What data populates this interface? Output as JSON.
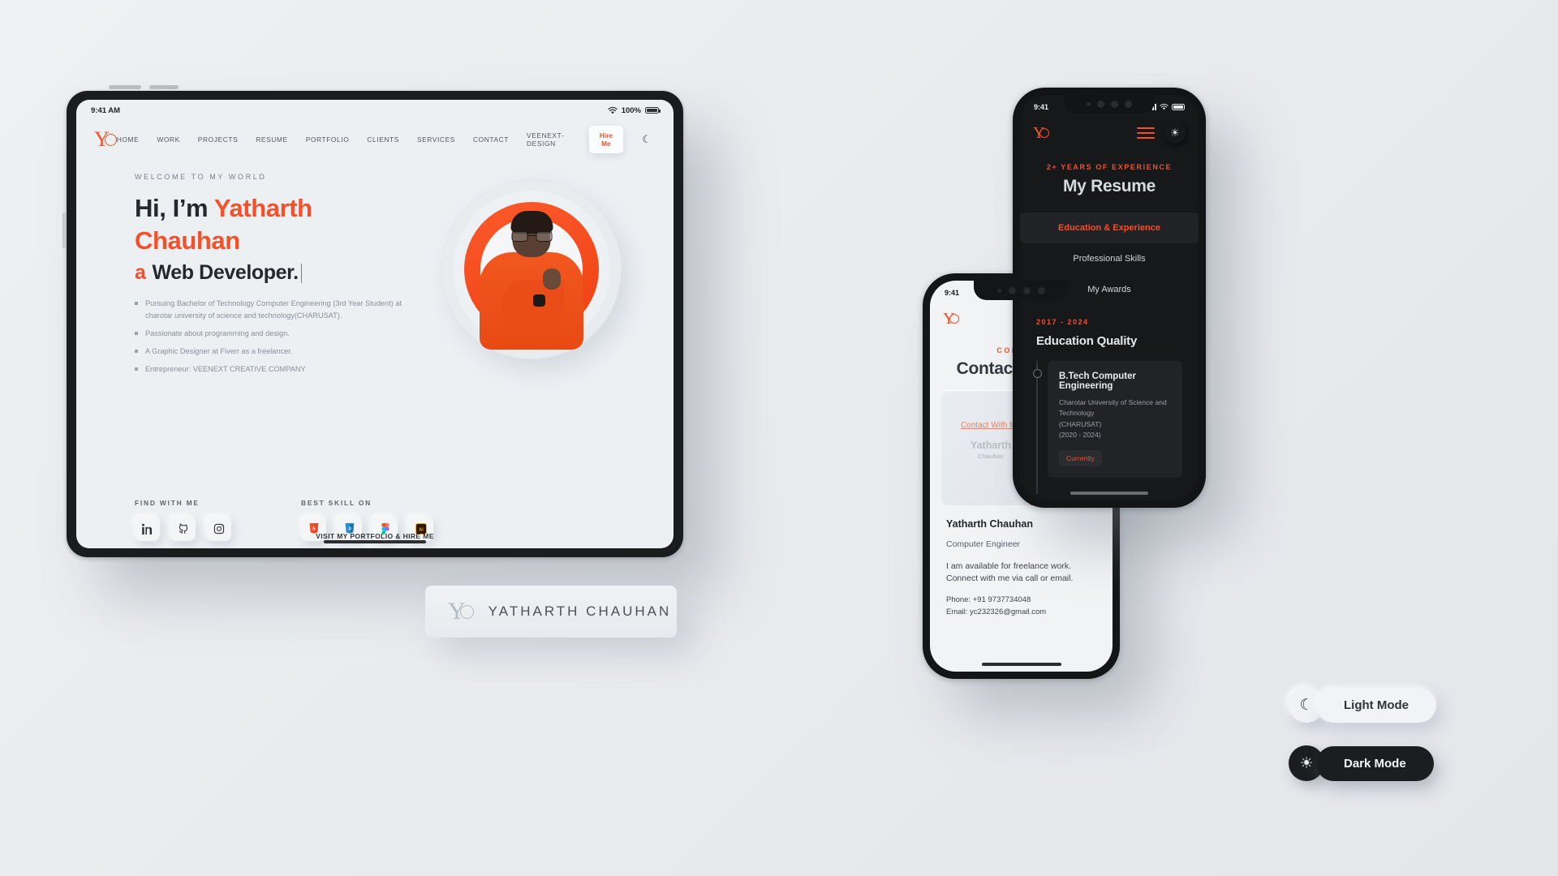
{
  "colors": {
    "accent": "#f4502a",
    "light_bg": "#edf0f3",
    "dark_bg": "#17181a",
    "dark_card": "#212326"
  },
  "tablet": {
    "status": {
      "time": "9:41 AM",
      "battery": "100%",
      "wifi_icon": "wifi-icon"
    },
    "logo": "YC",
    "nav": [
      {
        "label": "HOME"
      },
      {
        "label": "WORK"
      },
      {
        "label": "PROJECTS"
      },
      {
        "label": "RESUME"
      },
      {
        "label": "PORTFOLIO"
      },
      {
        "label": "CLIENTS"
      },
      {
        "label": "SERVICES"
      },
      {
        "label": "CONTACT"
      },
      {
        "label": "VEENEXT-DESIGN"
      }
    ],
    "hire_button": "Hire Me",
    "theme_toggle_icon": "moon-icon",
    "hero": {
      "eyebrow": "WELCOME TO MY WORLD",
      "greeting": "Hi, I’m ",
      "name": "Yatharth Chauhan",
      "role_article": "a",
      "role": "Web Developer.",
      "bullets": [
        "Pursuing Bachelor of Technology Computer Engineering (3rd Year Student) at charotar university of science and technology(CHARUSAT).",
        "Passionate about programming and design.",
        "A Graphic Designer at Fiverr as a freelancer.",
        "Entrepreneur: VEENEXT CREATIVE COMPANY"
      ]
    },
    "find_with_me": {
      "title": "FIND WITH ME",
      "items": [
        {
          "name": "linkedin-icon"
        },
        {
          "name": "github-icon"
        },
        {
          "name": "instagram-icon"
        }
      ]
    },
    "best_skill_on": {
      "title": "BEST SKILL ON",
      "items": [
        {
          "name": "html5-icon",
          "label": "5",
          "color": "#f4502a"
        },
        {
          "name": "css3-icon",
          "label": "3",
          "color": "#1f7fc4"
        },
        {
          "name": "figma-icon",
          "label": "",
          "color": "#f24e1e"
        },
        {
          "name": "illustrator-icon",
          "label": "Ai",
          "color": "#ff9a00"
        }
      ]
    },
    "footer_ghost": "VISIT MY PORTFOLIO & HIRE ME"
  },
  "brandbar": {
    "logo": "YC",
    "name": "YATHARTH CHAUHAN"
  },
  "phone_light": {
    "status": {
      "time": "9:41"
    },
    "logo": "YC",
    "menu_icon": "hamburger-icon",
    "theme_toggle_icon": "moon-icon",
    "eyebrow": "CONTACT",
    "title": "Contact With Me",
    "card": {
      "link": "Contact With Me",
      "name": "Yatharth",
      "subname": "Chauhan"
    },
    "info": {
      "name": "Yatharth Chauhan",
      "role": "Computer Engineer",
      "availability_line1": "I am available for freelance work.",
      "availability_line2": "Connect with me via call or email.",
      "phone": "Phone: +91 9737734048",
      "email": "Email: yc232326@gmail.com"
    }
  },
  "phone_dark": {
    "status": {
      "time": "9:41"
    },
    "logo": "YC",
    "menu_icon": "hamburger-icon",
    "theme_toggle_icon": "sun-icon",
    "eyebrow": "2+ YEARS OF EXPERIENCE",
    "title": "My Resume",
    "tabs": [
      {
        "label": "Education & Experience",
        "active": true
      },
      {
        "label": "Professional Skills",
        "active": false
      },
      {
        "label": "My Awards",
        "active": false
      }
    ],
    "section": {
      "years": "2017 - 2024",
      "heading": "Education Quality",
      "card": {
        "title": "B.Tech Computer Engineering",
        "line1": "Charotar University of Science and",
        "line2": "Technology",
        "line3": "(CHARUSAT)",
        "line4": "(2020 - 2024)",
        "badge": "Currently"
      }
    }
  },
  "mode_toggles": [
    {
      "label": "Light Mode",
      "icon": "moon-icon",
      "variant": "light"
    },
    {
      "label": "Dark Mode",
      "icon": "sun-icon",
      "variant": "dark"
    }
  ]
}
